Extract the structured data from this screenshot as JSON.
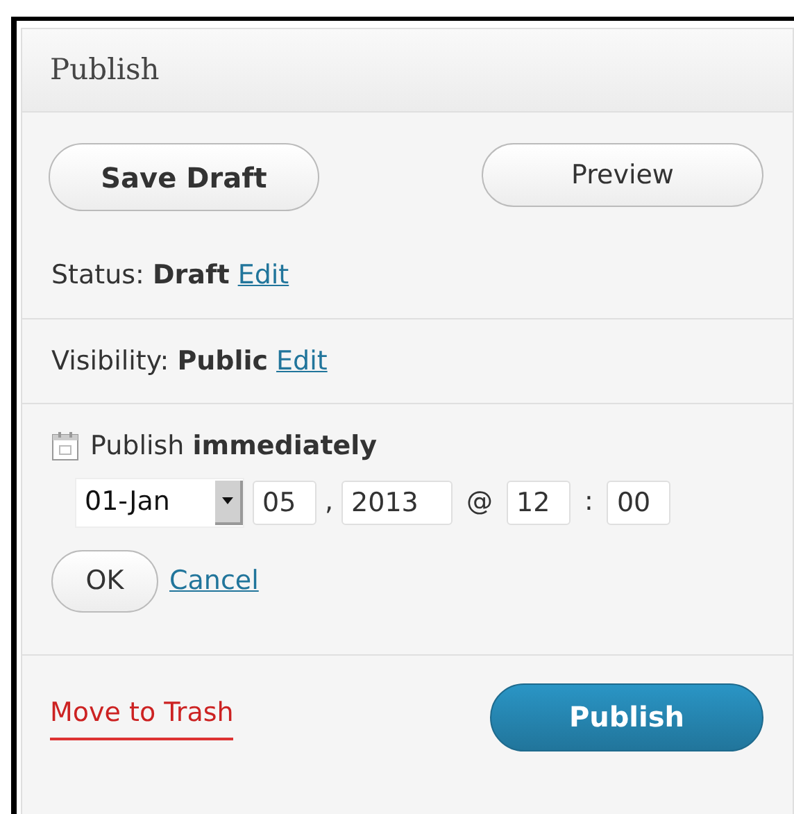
{
  "panel": {
    "title": "Publish"
  },
  "buttons": {
    "save_draft": "Save Draft",
    "preview": "Preview"
  },
  "status": {
    "text": "Status: **Draft**",
    "link": "Edit"
  },
  "visibility": {
    "text": "Visibility: **Public**",
    "link": "Edit"
  },
  "schedule": {
    "text": "Publish **immediately**",
    "month": "01-Jan",
    "day": "05",
    "comma": ",",
    "year": "2013",
    "at": "@",
    "hour": "12",
    "colon": ":",
    "minute": "00",
    "ok": "OK",
    "cancel": "Cancel"
  },
  "footer": {
    "trash": "Move to Trash",
    "publish": "Publish"
  }
}
